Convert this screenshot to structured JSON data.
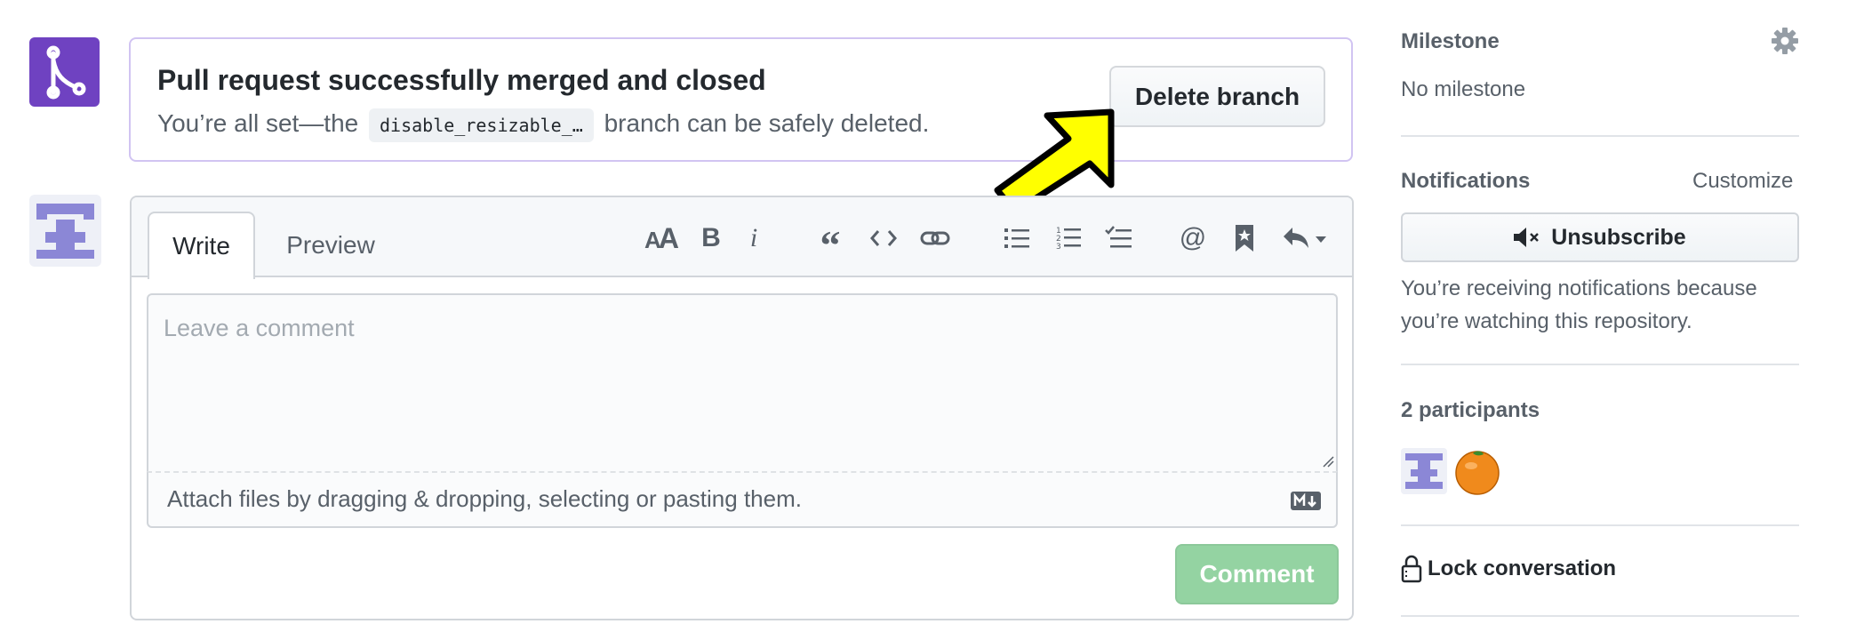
{
  "merge": {
    "title": "Pull request successfully merged and closed",
    "subtitle_prefix": "You’re all set—the",
    "branch_name": "disable_resizable_…",
    "subtitle_suffix": "branch can be safely deleted.",
    "delete_button": "Delete branch",
    "icon": "git-merge-icon",
    "accent_color": "#6f42c1"
  },
  "editor": {
    "tabs": [
      "Write",
      "Preview"
    ],
    "active_tab": "Write",
    "placeholder": "Leave a comment",
    "attach_text": "Attach files by dragging & dropping, selecting or pasting them.",
    "submit_label": "Comment",
    "toolbar_icons": [
      "text-size-icon",
      "bold-icon",
      "italic-icon",
      "quote-icon",
      "code-icon",
      "link-icon",
      "bulleted-list-icon",
      "numbered-list-icon",
      "task-list-icon",
      "mention-icon",
      "bookmark-icon",
      "reply-icon"
    ]
  },
  "sidebar": {
    "milestone_label": "Milestone",
    "milestone_value": "No milestone",
    "notifications_label": "Notifications",
    "customize_label": "Customize",
    "unsubscribe_label": "Unsubscribe",
    "notifications_reason": [
      "You’re receiving notifications because",
      "you’re watching this repository."
    ],
    "participants_label": "2 participants",
    "lock_label": "Lock conversation"
  }
}
